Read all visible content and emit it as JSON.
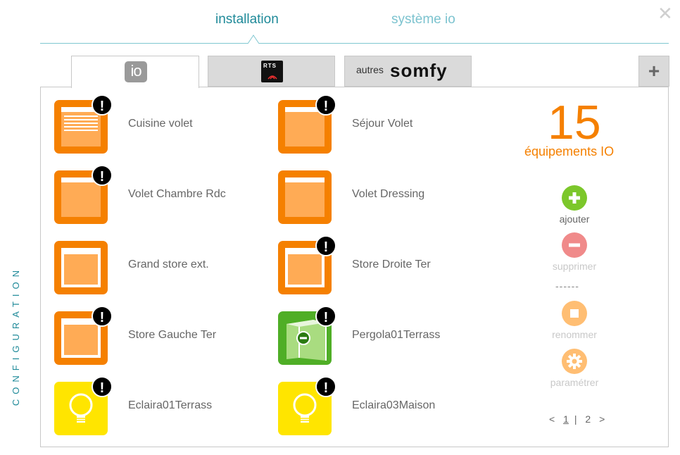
{
  "header": {
    "tab_installation": "installation",
    "tab_systeme": "système io",
    "close_glyph": "✕"
  },
  "protocol_tabs": {
    "io_label": "io",
    "rts_label": "RTS",
    "somfy_prefix": "autres",
    "somfy_brand": "somfy",
    "add_glyph": "+"
  },
  "devices": [
    {
      "label": "Cuisine volet",
      "type": "shutter-slats",
      "warning": true
    },
    {
      "label": "Séjour Volet",
      "type": "shutter",
      "warning": true
    },
    {
      "label": "Volet Chambre Rdc",
      "type": "shutter",
      "warning": true
    },
    {
      "label": "Volet Dressing",
      "type": "shutter",
      "warning": false
    },
    {
      "label": "Grand store ext.",
      "type": "store",
      "warning": false
    },
    {
      "label": "Store Droite Ter",
      "type": "store",
      "warning": true
    },
    {
      "label": "Store Gauche Ter",
      "type": "store",
      "warning": true
    },
    {
      "label": "Pergola01Terrass",
      "type": "pergola",
      "warning": true
    },
    {
      "label": "Eclaira01Terrass",
      "type": "light",
      "warning": true
    },
    {
      "label": "Eclaira03Maison",
      "type": "light",
      "warning": true
    }
  ],
  "summary": {
    "count": "15",
    "count_label": "équipements IO"
  },
  "actions": {
    "add": "ajouter",
    "remove": "supprimer",
    "separator": "------",
    "rename": "renommer",
    "settings": "paramétrer"
  },
  "pager": {
    "prev": "<",
    "page1": "1",
    "sep": "|",
    "page2": "2",
    "next": ">"
  },
  "side_label": "CONFIGURATION",
  "colors": {
    "accent": "#1f8a99",
    "orange": "#f58000",
    "green": "#4fae26",
    "yellow": "#ffe500",
    "add_green": "#7cc72b",
    "remove_red": "#f08a8a",
    "rename_orange": "#ffbe73"
  }
}
